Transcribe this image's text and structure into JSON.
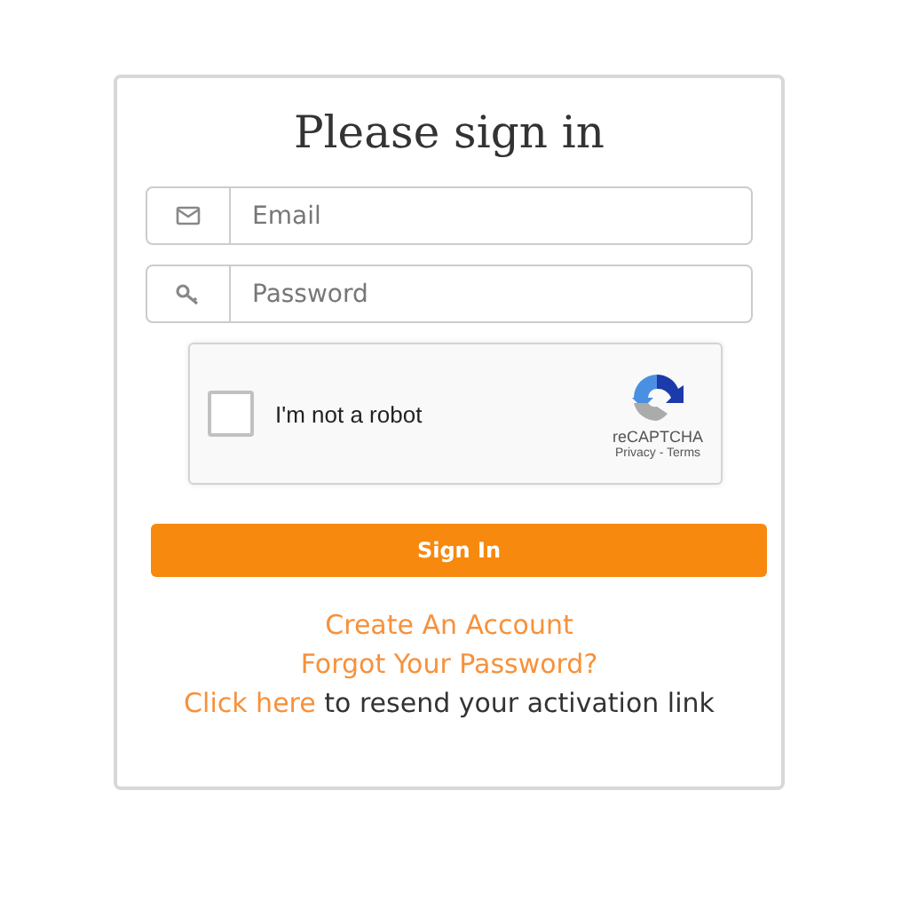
{
  "title": "Please sign in",
  "fields": [
    {
      "kind": "email",
      "placeholder": "Email"
    },
    {
      "kind": "password",
      "placeholder": "Password"
    }
  ],
  "captcha": {
    "label": "I'm not a robot",
    "checked": false,
    "brand": "reCAPTCHA",
    "footer": "Privacy - Terms"
  },
  "submit": "Sign In",
  "links": [
    "Create An Account",
    "Forgot Your Password?"
  ],
  "resend": {
    "link": "Click here",
    "text": "to resend your activation link"
  }
}
